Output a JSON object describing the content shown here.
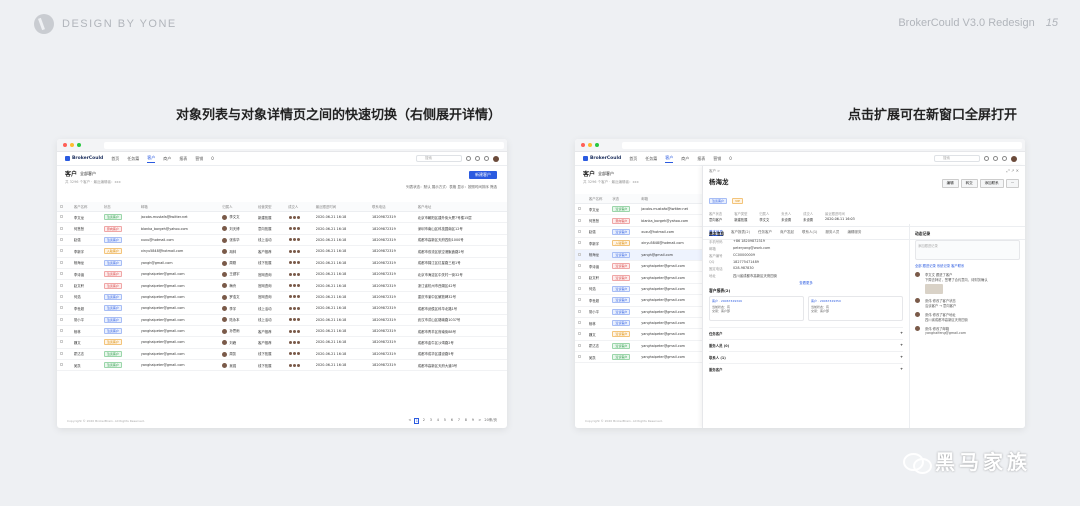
{
  "header": {
    "brand": "DESIGN BY YONE",
    "version": "BrokerCould V3.0 Redesign",
    "page_number": "15"
  },
  "captions": {
    "left": "对象列表与对象详情页之间的快速切换（右侧展开详情）",
    "right": "点击扩展可在新窗口全屏打开"
  },
  "app": {
    "logo": "BrokerCould",
    "nav": [
      "首页",
      "任务篇",
      "客户",
      "商户",
      "报表",
      "营销",
      "0"
    ],
    "active_nav": "客户",
    "search_placeholder": "搜索",
    "list_title": "客户",
    "list_filter": "全部客户",
    "list_meta": "共 3296 个客户 · 最近编辑者：xxx",
    "new_button": "新建客户",
    "tools": "列表状态：默认    展示方式：表格    显示：按照时间排序    筛选",
    "columns": [
      "客户名称",
      "状态",
      "邮箱",
      "归属人",
      "经营类型",
      "成交人",
      "最近跟进时间",
      "联系电话",
      "客户地址"
    ],
    "rows": [
      [
        "李文龙",
        "洽谈客户",
        "green",
        "jacobs.mustafa@twitter.net",
        "李文文",
        "新建拓展",
        "2020-06-21 16:18",
        "18209872319",
        "北京市朝阳区建外街大厦7号楼15层"
      ],
      [
        "何慧慧",
        "意向客户",
        "red",
        "blanka_borgeh@yahoo.com",
        "刘天博",
        "意向拓展",
        "2020-06-21 16:18",
        "18209872319",
        "深圳市南山区科技园南区12号"
      ],
      [
        "赵强",
        "洽谈客户",
        "blue",
        "xuxu@hotmail.com",
        "张伟华",
        "线上活动",
        "2020-06-21 16:18",
        "18209872319",
        "成都市高新区天府四街1000号"
      ],
      [
        "李新宇",
        "入驻客户",
        "orange",
        "xinyu5848@hotmail.com",
        "胡林",
        "客户推荐",
        "2020-06-21 16:18",
        "18209872319",
        "成都市双流区航空港聚鑫路2号"
      ],
      [
        "杨海龙",
        "洽谈客户",
        "blue",
        "yangh@gmail.com",
        "周刚",
        "线下拓展",
        "2020-06-21 16:18",
        "18209872319",
        "成都市锦江区红星路三段1号"
      ],
      [
        "李诗涵",
        "洽谈客户",
        "red",
        "yanghaipeter@gmail.com",
        "王健宇",
        "官网咨询",
        "2020-06-21 16:18",
        "18209872319",
        "北京市海淀区中关村一街32号"
      ],
      [
        "赵文轩",
        "洽谈客户",
        "red",
        "yanghaipeter@gmail.com",
        "梅舟",
        "官网咨询",
        "2020-06-21 16:18",
        "18209872319",
        "浙江省杭州市西湖区42号"
      ],
      [
        "何浩",
        "洽谈客户",
        "blue",
        "yanghaipeter@gmail.com",
        "罗浩文",
        "官网咨询",
        "2020-06-21 16:18",
        "18209872319",
        "重庆市渝中区解放碑32号"
      ],
      [
        "李世超",
        "洽谈客户",
        "blue",
        "yanghaipeter@gmail.com",
        "李宇",
        "线上活动",
        "2020-06-21 16:18",
        "18209872319",
        "成都市武侯区科华北路1号"
      ],
      [
        "常小平",
        "洽谈客户",
        "blue",
        "yanghaipeter@gmail.com",
        "陆永本",
        "线上活动",
        "2020-06-21 16:18",
        "18209872319",
        "武汉市洪山区珞喻路1037号"
      ],
      [
        "杨林",
        "洽谈客户",
        "blue",
        "yanghaipeter@gmail.com",
        "孙思雨",
        "客户推荐",
        "2020-06-21 16:18",
        "18209872319",
        "成都市青羊区府南街88号"
      ],
      [
        "魏文",
        "洽谈客户",
        "orange",
        "yanghaipeter@gmail.com",
        "刘峰",
        "客户推荐",
        "2020-06-21 16:18",
        "18209872319",
        "成都市金牛区沙湾路2号"
      ],
      [
        "霍达志",
        "洽谈客户",
        "green",
        "yanghaipeter@gmail.com",
        "周凯",
        "线下拓展",
        "2020-06-21 16:18",
        "18209872319",
        "成都市成华区建设路5号"
      ],
      [
        "吴凯",
        "洽谈客户",
        "green",
        "yanghaipeter@gmail.com",
        "吴强",
        "线下拓展",
        "2020-06-21 16:18",
        "18209872319",
        "成都市高新区天府大道3号"
      ]
    ],
    "copyright": "Copyright © 2020 BrokerBrain. All Rights Reserved.",
    "pager": [
      "<",
      "1",
      "2",
      "3",
      "4",
      "5",
      "6",
      "7",
      "8",
      "9",
      ">",
      "20条/页"
    ]
  },
  "detail": {
    "crumb": "客户 >",
    "title": "杨海龙",
    "tags": [
      "洽谈客户",
      "VIP"
    ],
    "actions": [
      "编辑",
      "转交",
      "添加联系",
      "···"
    ],
    "fields": [
      {
        "k": "客户状态",
        "v": "意向客户"
      },
      {
        "k": "客户类型",
        "v": "新建拓展"
      },
      {
        "k": "归属人",
        "v": "李文文"
      },
      {
        "k": "负责人",
        "v": "未设置"
      },
      {
        "k": "成交人",
        "v": "未设置"
      },
      {
        "k": "最近跟进时间",
        "v": "2020-06-11 16:03"
      }
    ],
    "tabs": [
      "基本信息",
      "客户报表(2)",
      "任务客户",
      "商户发起",
      "联系人(1)",
      "服务人员",
      "编辑服务"
    ],
    "section_basic": "基本信息",
    "basic": [
      {
        "k": "手机号码",
        "v": "+86 18209872319"
      },
      {
        "k": "邮箱",
        "v": "peteryang@work.com"
      },
      {
        "k": "客户编号",
        "v": "CC00000009"
      },
      {
        "k": "QQ",
        "v": "182775471489"
      },
      {
        "k": "固定电话",
        "v": "028-987830"
      },
      {
        "k": "地址",
        "v": "四川省成都市高新区天府四街"
      }
    ],
    "more": "查看更多",
    "section_report": "客户报表(2)",
    "cards": [
      {
        "title": "客户 · 20067329349",
        "line1": "当前状态：有",
        "line2": "交易：客户部"
      },
      {
        "title": "客户 · 20067329350",
        "line1": "当前状态：有",
        "line2": "交易：客户部"
      }
    ],
    "collapsed": [
      "任务客户",
      "服务人员  (0)",
      "联系人  (1)",
      "服务客户"
    ],
    "side_title": "动态记录",
    "side_placeholder": "添加跟进记录",
    "side_tabs": "全部  跟进记录  系统记录  客户联系",
    "activities": [
      {
        "who": "李文文",
        "what": "跟进了客户",
        "text": "下周去拜访，签署了合约意向，待财务确认"
      },
      {
        "who": "张伟",
        "what": "修改了客户状态",
        "text": "洽谈客户 → 意向客户"
      },
      {
        "who": "张伟",
        "what": "修改了客户地址",
        "text": "四川省成都市高新区天府四街"
      },
      {
        "who": "张伟",
        "what": "修改了邮箱",
        "text": "yanghaifeng@gmail.com"
      }
    ]
  },
  "watermark": "黑马家族",
  "colors": {
    "accent": "#2b5be0",
    "background": "#eef0f3"
  }
}
